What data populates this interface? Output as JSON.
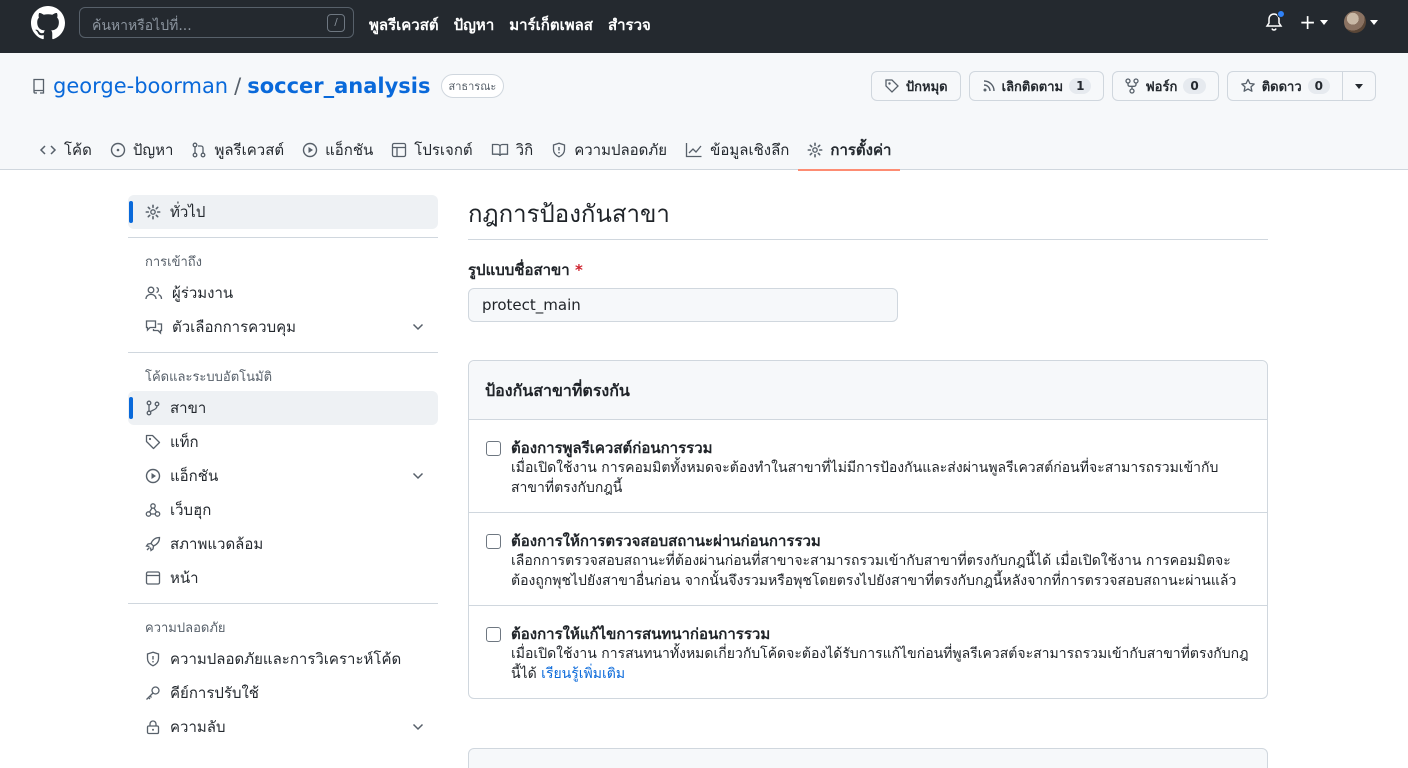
{
  "header": {
    "search_placeholder": "ค้นหาหรือไปที่...",
    "search_key": "/",
    "nav": [
      "พูลรีเควสต์",
      "ปัญหา",
      "มาร์เก็ตเพลส",
      "สำรวจ"
    ],
    "plus": "+"
  },
  "repo": {
    "owner": "george-boorman",
    "slash": "/",
    "name": "soccer_analysis",
    "visibility": "สาธารณะ",
    "actions": {
      "pin": "ปักหมุด",
      "unwatch": "เลิกติดตาม",
      "unwatch_count": "1",
      "fork": "ฟอร์ก",
      "fork_count": "0",
      "star": "ติดดาว",
      "star_count": "0"
    },
    "tabs": [
      {
        "label": "โค้ด",
        "icon": "code-icon"
      },
      {
        "label": "ปัญหา",
        "icon": "issue-icon"
      },
      {
        "label": "พูลรีเควสต์",
        "icon": "pull-request-icon"
      },
      {
        "label": "แอ็กชัน",
        "icon": "play-icon"
      },
      {
        "label": "โปรเจกต์",
        "icon": "table-icon"
      },
      {
        "label": "วิกิ",
        "icon": "book-icon"
      },
      {
        "label": "ความปลอดภัย",
        "icon": "shield-icon"
      },
      {
        "label": "ข้อมูลเชิงลึก",
        "icon": "graph-icon"
      },
      {
        "label": "การตั้งค่า",
        "icon": "gear-icon"
      }
    ]
  },
  "sidebar": {
    "general": "ทั่วไป",
    "access_heading": "การเข้าถึง",
    "collaborators": "ผู้ร่วมงาน",
    "moderation": "ตัวเลือกการควบคุม",
    "code_heading": "โค้ดและระบบอัตโนมัติ",
    "branches": "สาขา",
    "tags": "แท็ก",
    "actions": "แอ็กชัน",
    "webhooks": "เว็บฮุก",
    "environments": "สภาพแวดล้อม",
    "pages": "หน้า",
    "security_heading": "ความปลอดภัย",
    "code_security": "ความปลอดภัยและการวิเคราะห์โค้ด",
    "deploy_keys": "คีย์การปรับใช้",
    "secrets": "ความลับ"
  },
  "main": {
    "title": "กฎการป้องกันสาขา",
    "pattern_label": "รูปแบบชื่อสาขา",
    "required_mark": "*",
    "pattern_value": "protect_main",
    "protect_heading": "ป้องกันสาขาที่ตรงกัน",
    "rules": [
      {
        "title": "ต้องการพูลรีเควสต์ก่อนการรวม",
        "desc": "เมื่อเปิดใช้งาน การคอมมิตทั้งหมดจะต้องทำในสาขาที่ไม่มีการป้องกันและส่งผ่านพูลรีเควสต์ก่อนที่จะสามารถรวมเข้ากับสาขาที่ตรงกับกฎนี้"
      },
      {
        "title": "ต้องการให้การตรวจสอบสถานะผ่านก่อนการรวม",
        "desc": "เลือกการตรวจสอบสถานะที่ต้องผ่านก่อนที่สาขาจะสามารถรวมเข้ากับสาขาที่ตรงกับกฎนี้ได้ เมื่อเปิดใช้งาน การคอมมิตจะต้องถูกพุชไปยังสาขาอื่นก่อน จากนั้นจึงรวมหรือพุชโดยตรงไปยังสาขาที่ตรงกับกฎนี้หลังจากที่การตรวจสอบสถานะผ่านแล้ว"
      },
      {
        "title": "ต้องการให้แก้ไขการสนทนาก่อนการรวม",
        "desc": "เมื่อเปิดใช้งาน การสนทนาทั้งหมดเกี่ยวกับโค้ดจะต้องได้รับการแก้ไขก่อนที่พูลรีเควสต์จะสามารถรวมเข้ากับสาขาที่ตรงกับกฎนี้ได้",
        "link": "เรียนรู้เพิ่มเติม"
      }
    ]
  }
}
